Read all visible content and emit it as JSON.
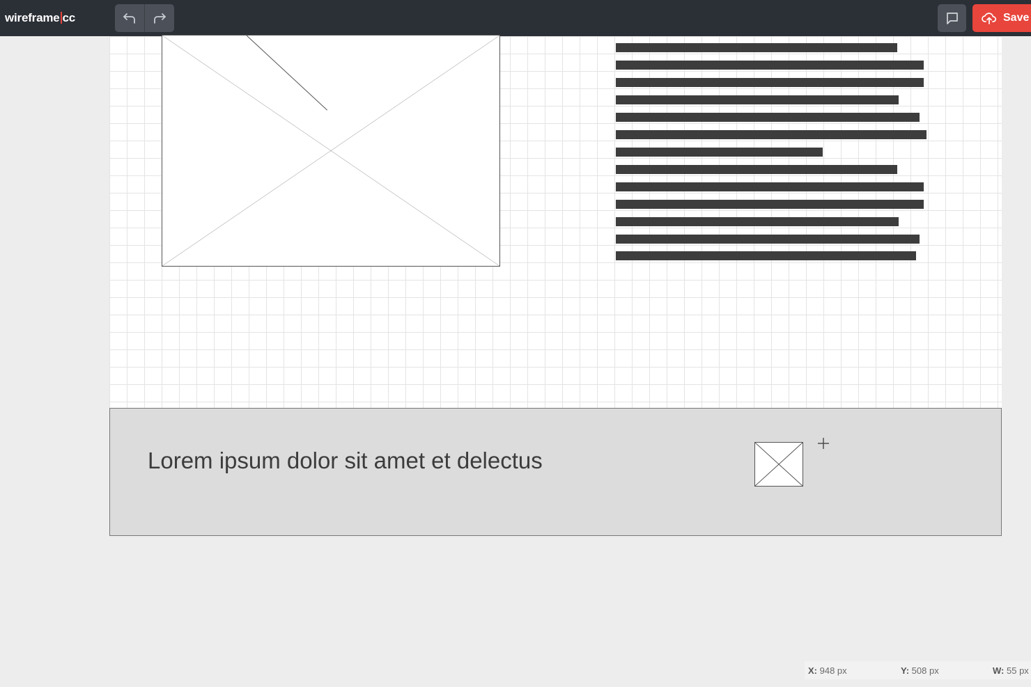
{
  "app": {
    "logo_text": "wireframe",
    "logo_suffix": "cc",
    "accent_color": "#e8453c",
    "topbar_color": "#2b2f36"
  },
  "toolbar": {
    "undo_icon": "undo-arrow-icon",
    "redo_icon": "redo-arrow-icon",
    "comment_icon": "speech-bubble-icon",
    "save_icon": "cloud-upload-icon",
    "save_label": "Save"
  },
  "canvas": {
    "image_placeholder_icon": "image-placeholder-x-icon",
    "text_block_lines": 13
  },
  "footer_band": {
    "text": "Lorem ipsum dolor sit amet et delectus",
    "image_icon": "image-placeholder-x-icon",
    "cursor_icon": "crosshair-cursor-icon"
  },
  "status": {
    "x_label": "X:",
    "x_value": "948 px",
    "y_label": "Y:",
    "y_value": "508 px",
    "w_label": "W:",
    "w_value": "55 px"
  }
}
